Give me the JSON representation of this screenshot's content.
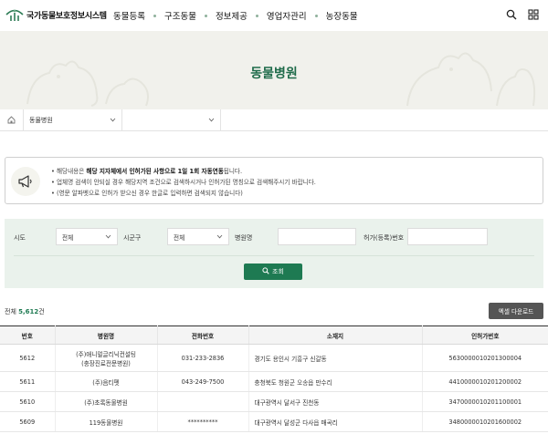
{
  "header": {
    "logo_text": "국가동물보호정보시스템",
    "nav": [
      "동물등록",
      "구조동물",
      "정보제공",
      "영업자관리",
      "농장동물"
    ],
    "icons": [
      "search-icon",
      "grid-menu-icon"
    ]
  },
  "banner": {
    "title": "동물병원"
  },
  "breadcrumb": {
    "level1": "동물병원",
    "level2": ""
  },
  "notice": {
    "line1_pre": "• 해당내용은 ",
    "line1_bold": "해당 지자체에서 인허가된 사항으로 1일 1회 자동연동",
    "line1_post": "됩니다.",
    "line2": "• 업체명 검색이 안되실 경우 해당지역 조건으로 검색하시거나 인허가된 명칭으로 검색해주시기 바랍니다.",
    "line3": "• (영문 알파벳으로 인허가 받으신 경우 한글로 입력하면 검색되지 않습니다)"
  },
  "search": {
    "sido_label": "시도",
    "sido_value": "전체",
    "sigungu_label": "시군구",
    "sigungu_value": "전체",
    "hospital_label": "병원명",
    "hospital_value": "",
    "license_label": "허가(등록)번호",
    "license_value": "",
    "submit_label": "조회"
  },
  "results": {
    "total_prefix": "전체 ",
    "total_count": "5,612",
    "total_suffix": "건",
    "excel_label": "엑셀 다운로드"
  },
  "table": {
    "headers": [
      "번호",
      "병원명",
      "전화번호",
      "소재지",
      "인허가번호"
    ],
    "rows": [
      {
        "no": "5612",
        "name1": "(주)애니멀글리닉컨설팅",
        "name2": "(충장진료전문병원)",
        "phone": "031-233-2836",
        "addr": "경기도 용인시 기흥구 신갈동",
        "license": "5630000010201300004"
      },
      {
        "no": "5611",
        "name1": "(주)음티펫",
        "name2": "",
        "phone": "043-249-7500",
        "addr": "충청북도 청원군 오송읍 만수리",
        "license": "4410000010201200002"
      },
      {
        "no": "5610",
        "name1": "(주)초록동물병원",
        "name2": "",
        "phone": "",
        "addr": "대구광역시 달서구 진천동",
        "license": "3470000010201100001"
      },
      {
        "no": "5609",
        "name1": "119동물병원",
        "name2": "",
        "phone": "**********",
        "addr": "대구광역시 달성군 다사읍 매곡리",
        "license": "3480000010201600002"
      }
    ]
  },
  "colors": {
    "brand_green": "#1e7a52",
    "search_bg": "#eaf2ec",
    "banner_bg": "#f1f1ec"
  }
}
